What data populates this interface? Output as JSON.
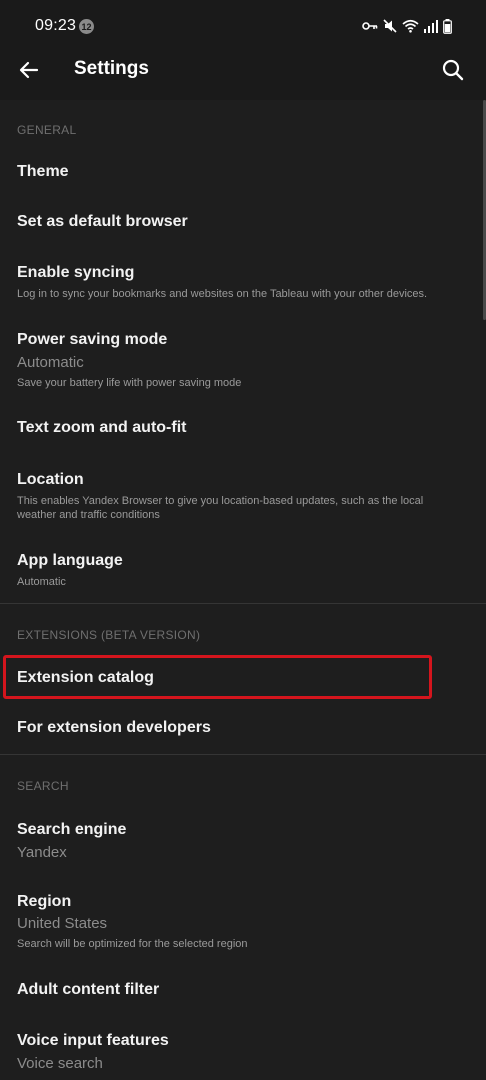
{
  "status_bar": {
    "time": "09:23",
    "notification_count": "12",
    "icons": [
      "key-icon",
      "mute-icon",
      "wifi-icon",
      "signal-icon",
      "battery-icon"
    ]
  },
  "app_bar": {
    "title": "Settings",
    "back_icon": "back-arrow-icon",
    "search_icon": "search-icon"
  },
  "sections": {
    "general": {
      "header": "GENERAL",
      "items": {
        "theme": {
          "title": "Theme"
        },
        "default_browser": {
          "title": "Set as default browser"
        },
        "syncing": {
          "title": "Enable syncing",
          "description": "Log in to sync your bookmarks and websites on the Tableau with your other devices."
        },
        "power_saving": {
          "title": "Power saving mode",
          "value": "Automatic",
          "description": "Save your battery life with power saving mode"
        },
        "text_zoom": {
          "title": "Text zoom and auto-fit"
        },
        "location": {
          "title": "Location",
          "description": "This enables Yandex Browser to give you location-based updates, such as the local weather and traffic conditions"
        },
        "app_language": {
          "title": "App language",
          "description": "Automatic"
        }
      }
    },
    "extensions": {
      "header": "EXTENSIONS (BETA VERSION)",
      "items": {
        "catalog": {
          "title": "Extension catalog"
        },
        "developers": {
          "title": "For extension developers"
        }
      }
    },
    "search": {
      "header": "SEARCH",
      "items": {
        "engine": {
          "title": "Search engine",
          "value": "Yandex"
        },
        "region": {
          "title": "Region",
          "value": "United States",
          "description": "Search will be optimized for the selected region"
        },
        "adult_filter": {
          "title": "Adult content filter"
        },
        "voice_input": {
          "title": "Voice input features",
          "value": "Voice search"
        }
      }
    }
  },
  "colors": {
    "background": "#1e1e1e",
    "highlight": "#d4151d",
    "section_header": "#6f6f6f"
  }
}
